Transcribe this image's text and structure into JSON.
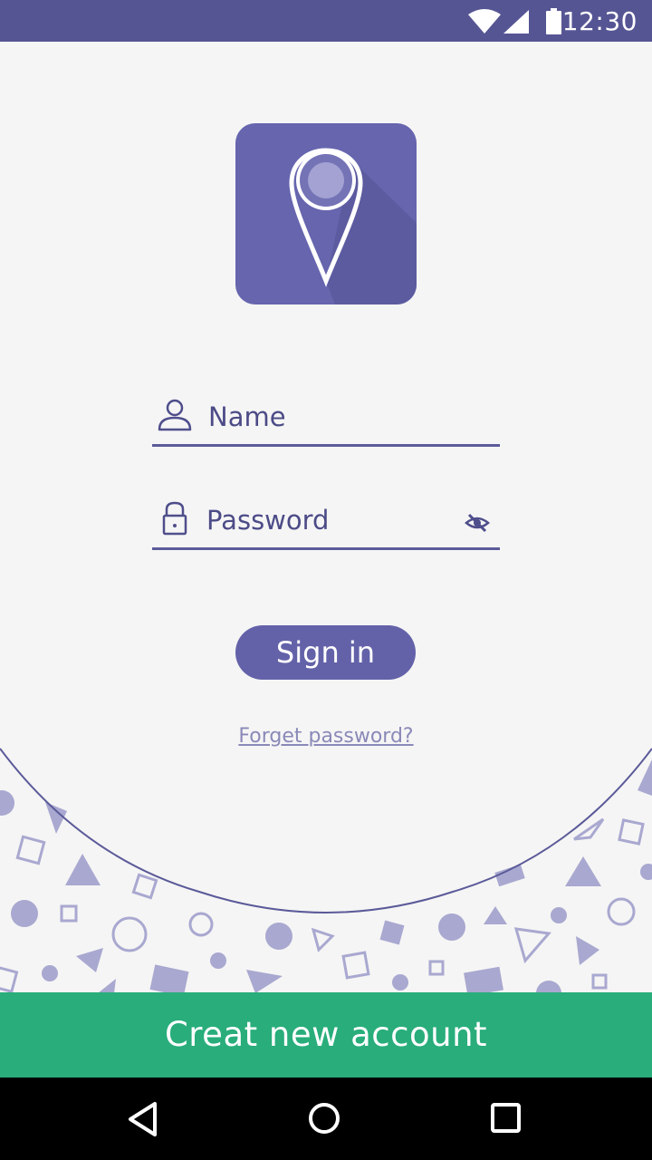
{
  "status_bar": {
    "time": "12:30",
    "icons": [
      "wifi-icon",
      "signal-icon",
      "battery-icon"
    ],
    "background": "#565594"
  },
  "logo": {
    "icon": "location-pin-icon",
    "background": "#6665ae"
  },
  "form": {
    "name_field": {
      "icon": "user-icon",
      "placeholder": "Name",
      "value": ""
    },
    "password_field": {
      "icon": "lock-icon",
      "placeholder": "Password",
      "value": "",
      "toggle_icon": "eye-off-icon"
    },
    "sign_in_label": "Sign in",
    "forgot_label": "Forget password?"
  },
  "footer": {
    "create_account_label": "Creat new account",
    "button_color": "#28ad7b"
  },
  "nav": {
    "icons": [
      "back-triangle-icon",
      "home-circle-icon",
      "recent-square-icon"
    ]
  },
  "colors": {
    "accent": "#6362a9",
    "background": "#f5f5f5",
    "pattern": "#a9a8d0"
  }
}
